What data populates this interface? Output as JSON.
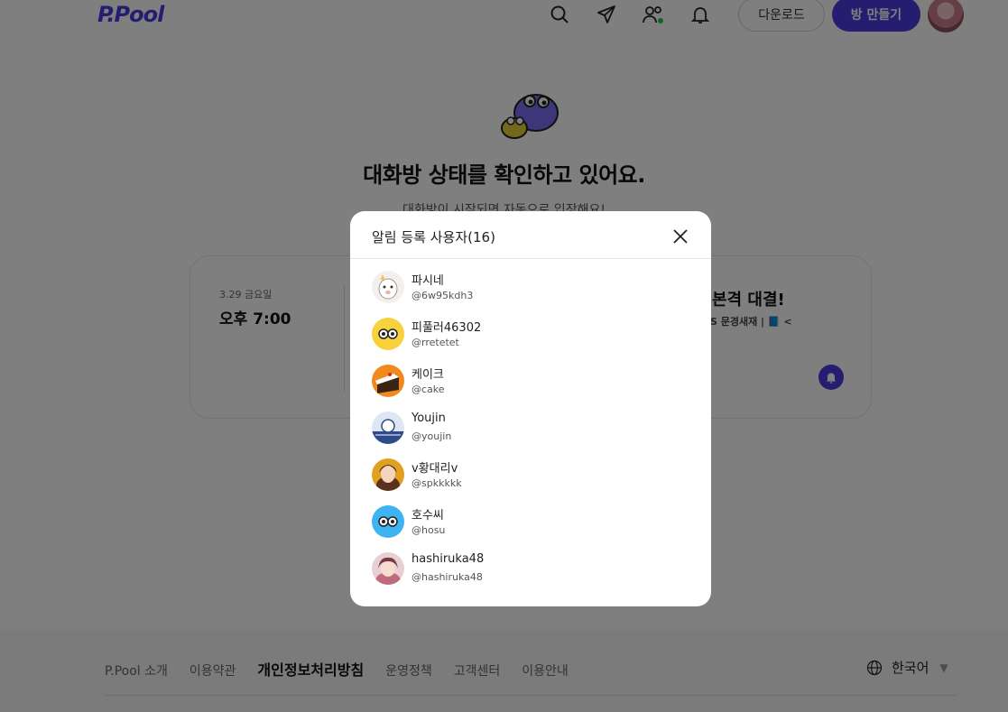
{
  "header": {
    "logo": "P.Pool",
    "download_label": "다운로드",
    "make_room_label": "방 만들기",
    "icons": [
      "search-icon",
      "send-icon",
      "friends-icon",
      "bell-icon"
    ],
    "friends_online_color": "#22c55e"
  },
  "main": {
    "title": "대화방 상태를 확인하고 있어요.",
    "subtitle": "대화방이 시작되면 자동으로 입장해요!"
  },
  "event": {
    "date": "3.29 금요일",
    "time": "오후 7:00",
    "title": "본격 대결!",
    "meta": "S 문경새재 | 📘 <"
  },
  "modal": {
    "title": "알림 등록 사용자(16)",
    "users": [
      {
        "name": "파시네",
        "handle": "@6w95kdh3"
      },
      {
        "name": "피풀러46302",
        "handle": "@rretetet"
      },
      {
        "name": "케이크",
        "handle": "@cake"
      },
      {
        "name": "Youjin",
        "handle": "@youjin"
      },
      {
        "name": "v황대리v",
        "handle": "@spkkkkk"
      },
      {
        "name": "호수씨",
        "handle": "@hosu"
      },
      {
        "name": "hashiruka48",
        "handle": "@hashiruka48"
      }
    ]
  },
  "footer": {
    "links": [
      "P.Pool 소개",
      "이용약관",
      "개인정보처리방침",
      "운영정책",
      "고객센터",
      "이용안내"
    ],
    "language": "한국어"
  },
  "colors": {
    "brand": "#4a3ce0",
    "overlay": "rgba(0,0,0,0.5)"
  }
}
